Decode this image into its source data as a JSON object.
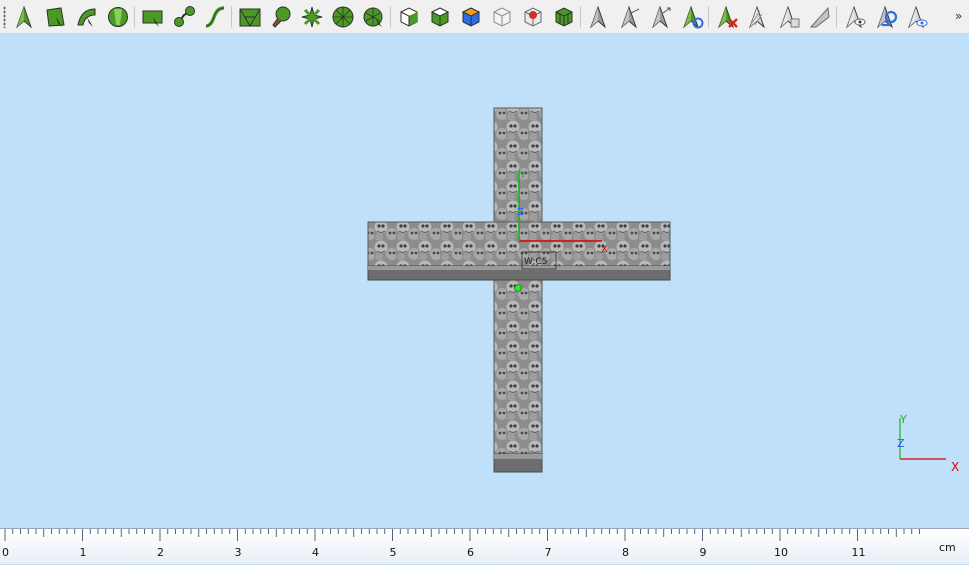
{
  "toolbar": {
    "groups": [
      [
        "select-arrow-icon",
        "select-face-icon",
        "select-curve-icon",
        "select-circle-icon"
      ],
      [
        "rectangle-select-icon",
        "lasso-node-icon",
        "freehand-curve-icon"
      ],
      [
        "mesh-select-icon",
        "brush-select-icon",
        "spoke-select-icon",
        "wheel-select-icon",
        "radial-select-icon"
      ],
      [
        "cube-view-icon",
        "cube-front-icon",
        "cube-top-icon",
        "cube-wire-icon",
        "cube-paint-icon",
        "cube-grid-icon"
      ],
      [
        "arrow-grey-icon",
        "arrow-split-icon",
        "arrow-move-icon",
        "arrow-refresh-icon"
      ],
      [
        "delete-arrow-icon",
        "arrow-hatched-icon",
        "arrow-copy-icon",
        "arrow-diagonal-icon"
      ],
      [
        "eye-arrow-icon",
        "sync-arrow-icon",
        "eye-hide-icon"
      ]
    ],
    "overflow_label": "»"
  },
  "viewport": {
    "background": "#bfe0fa",
    "object_axis": {
      "x_label": "X",
      "y_label": "Y",
      "z_label": "Z",
      "tag": "W:C5"
    },
    "corner_axis": {
      "x_label": "X",
      "y_label": "Y",
      "z_label": "Z"
    },
    "colors": {
      "x_axis": "#e00000",
      "y_axis": "#22b022",
      "z_axis": "#2a5cff"
    }
  },
  "ruler": {
    "labels": [
      "0",
      "1",
      "2",
      "3",
      "4",
      "5",
      "6",
      "7",
      "8",
      "9",
      "10",
      "11"
    ],
    "unit": "cm"
  }
}
